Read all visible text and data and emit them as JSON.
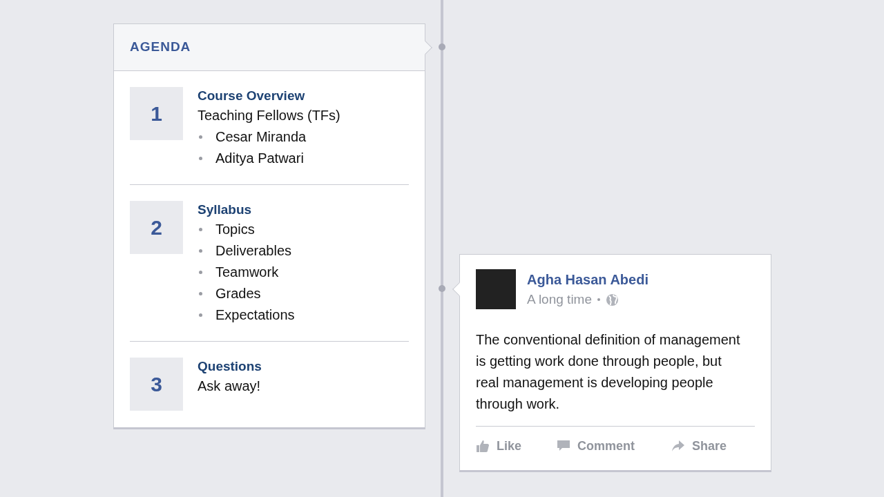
{
  "agenda": {
    "title": "AGENDA",
    "items": [
      {
        "number": "1",
        "title": "Course Overview",
        "lines": [
          {
            "kind": "text",
            "text": "Teaching Fellows (TFs)"
          },
          {
            "kind": "bullet",
            "text": "Cesar Miranda"
          },
          {
            "kind": "bullet",
            "text": "Aditya Patwari"
          }
        ]
      },
      {
        "number": "2",
        "title": "Syllabus",
        "lines": [
          {
            "kind": "bullet",
            "text": "Topics"
          },
          {
            "kind": "bullet",
            "text": "Deliverables"
          },
          {
            "kind": "bullet",
            "text": "Teamwork"
          },
          {
            "kind": "bullet",
            "text": "Grades"
          },
          {
            "kind": "bullet",
            "text": "Expectations"
          }
        ]
      },
      {
        "number": "3",
        "title": "Questions",
        "lines": [
          {
            "kind": "text",
            "text": "Ask away!"
          }
        ]
      }
    ]
  },
  "post": {
    "author": "Agha Hasan Abedi",
    "time": "A long time",
    "text": "The conventional definition of management is getting work done through people, but real management is developing people through work.",
    "actions": [
      {
        "kind": "like",
        "label": "Like"
      },
      {
        "kind": "comment",
        "label": "Comment"
      },
      {
        "kind": "share",
        "label": "Share"
      }
    ]
  }
}
